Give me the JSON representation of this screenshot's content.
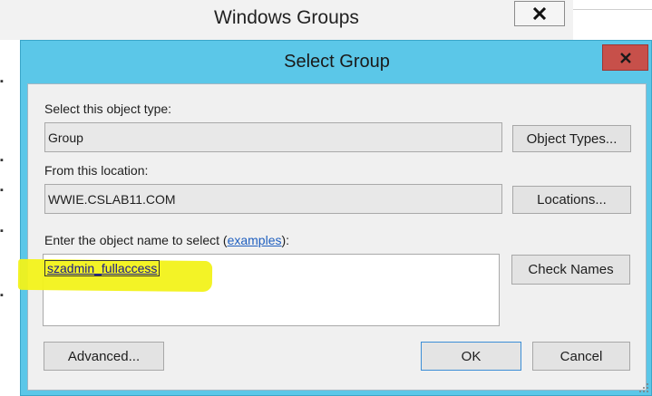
{
  "background_window": {
    "title": "Windows Groups",
    "close_glyph": "close-icon",
    "left_marks": [
      "▪",
      "▪",
      "▪",
      "▪",
      "▪"
    ]
  },
  "dialog": {
    "title": "Select Group",
    "close_glyph": "close-icon",
    "object_type": {
      "label": "Select this object type:",
      "value": "Group",
      "button": "Object Types..."
    },
    "location": {
      "label": "From this location:",
      "value": "WWIE.CSLAB11.COM",
      "button": "Locations..."
    },
    "object_name": {
      "label_prefix": "Enter the object name to select (",
      "label_link": "examples",
      "label_suffix": "):",
      "value": "szadmin_fullaccess",
      "button": "Check Names"
    },
    "footer": {
      "advanced_button": "Advanced...",
      "ok_button": "OK",
      "cancel_button": "Cancel"
    }
  },
  "colors": {
    "dialog_frame": "#5bc7e8",
    "close_button": "#c7504a",
    "highlight": "#f2f21a"
  }
}
